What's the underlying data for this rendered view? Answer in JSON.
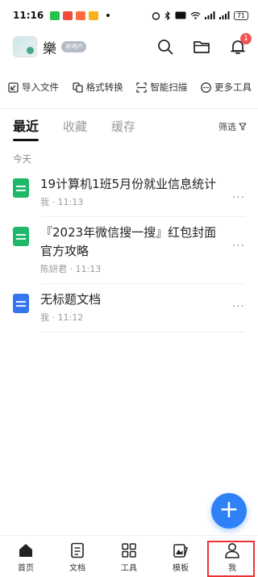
{
  "status_bar": {
    "time": "11:16",
    "battery": "71"
  },
  "header": {
    "username": "樂",
    "badge": "新用户",
    "notification_count": "1"
  },
  "tools": [
    {
      "label": "导入文件",
      "icon": "import-icon"
    },
    {
      "label": "格式转换",
      "icon": "convert-icon"
    },
    {
      "label": "智能扫描",
      "icon": "scan-icon"
    },
    {
      "label": "更多工具",
      "icon": "more-tools-icon"
    }
  ],
  "tabs": [
    {
      "label": "最近",
      "active": true
    },
    {
      "label": "收藏",
      "active": false
    },
    {
      "label": "缓存",
      "active": false
    }
  ],
  "filter_label": "筛选",
  "section_title": "今天",
  "files": [
    {
      "name": "19计算机1班5月份就业信息统计",
      "meta": "我 · 11:13",
      "type": "sheet"
    },
    {
      "name": "『2023年微信搜一搜』红包封面官方攻略",
      "meta": "陈妍君 · 11:13",
      "type": "sheet"
    },
    {
      "name": "无标题文档",
      "meta": "我 · 11:12",
      "type": "doc"
    }
  ],
  "more_label": "···",
  "fab_label": "+",
  "nav": [
    {
      "label": "首页",
      "icon": "home-icon"
    },
    {
      "label": "文档",
      "icon": "document-icon"
    },
    {
      "label": "工具",
      "icon": "tools-grid-icon"
    },
    {
      "label": "模板",
      "icon": "template-icon"
    },
    {
      "label": "我",
      "icon": "profile-icon"
    }
  ],
  "colors": {
    "accent": "#2f81f7",
    "sheet": "#1fb76a",
    "doc": "#3476f1",
    "highlight": "#ee3333"
  }
}
